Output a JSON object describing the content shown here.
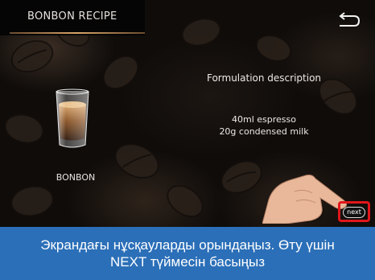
{
  "header": {
    "title": "BONBON RECIPE"
  },
  "drink": {
    "name": "BONBON"
  },
  "description": {
    "title": "Formulation description",
    "ingredients": [
      "40ml espresso",
      "20g condensed milk"
    ]
  },
  "buttons": {
    "next_label": "next"
  },
  "instruction": {
    "line1": "Экрандағы нұсқауларды орындаңыз. Өту үшін",
    "line2": "NEXT түймесін басыңыз"
  },
  "colors": {
    "highlight": "#e0161b",
    "caption_bg": "#2b6fb8"
  }
}
